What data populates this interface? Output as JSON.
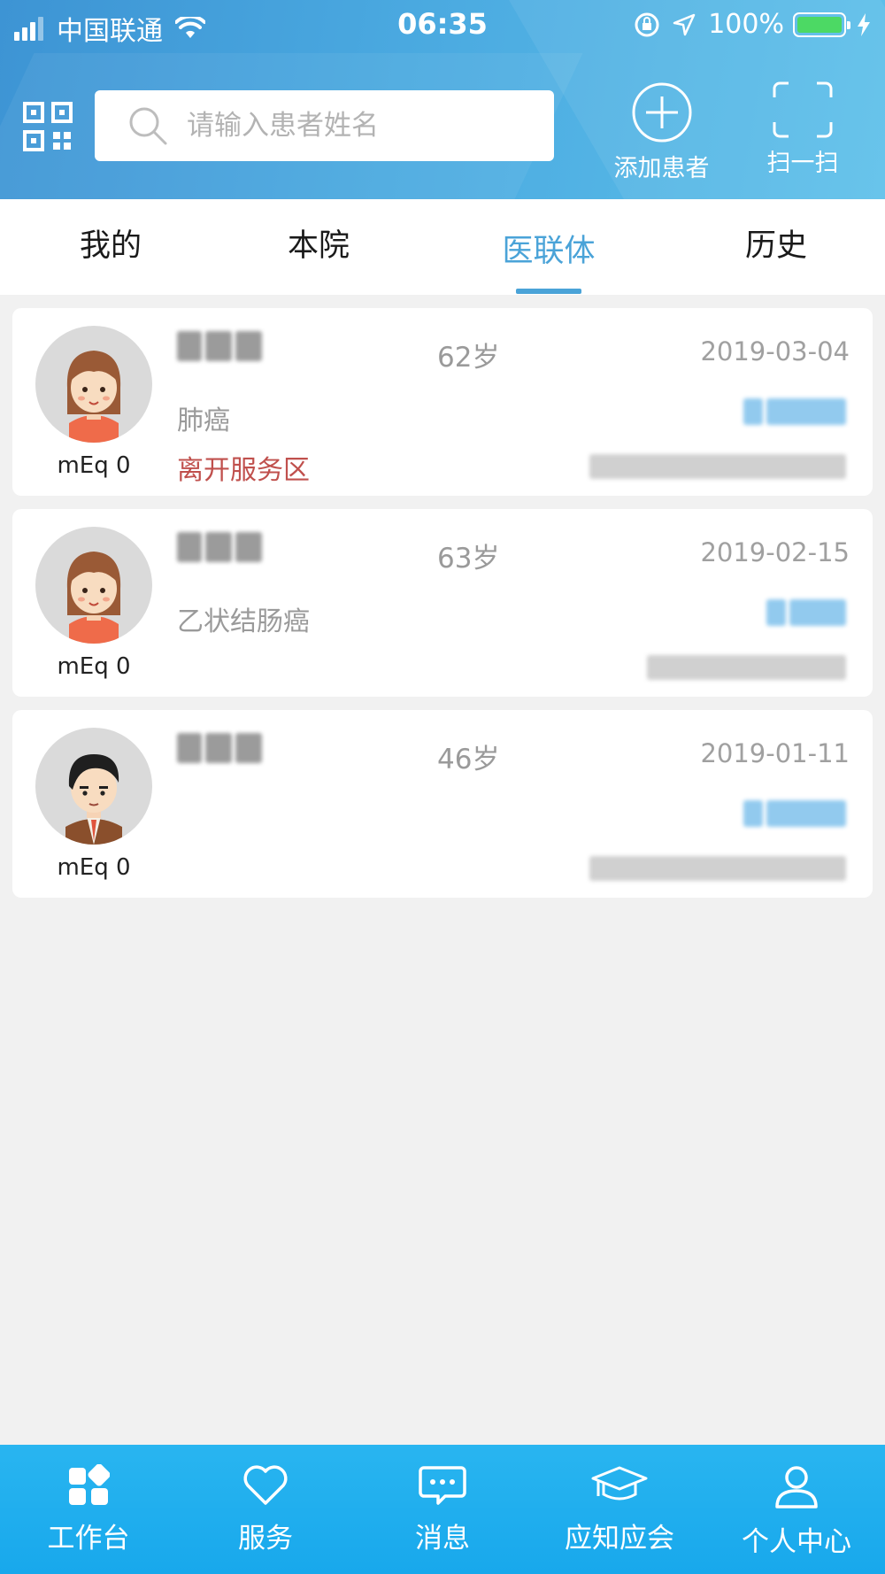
{
  "status_bar": {
    "carrier": "中国联通",
    "time": "06:35",
    "battery": "100%"
  },
  "header": {
    "search_placeholder": "请输入患者姓名",
    "add_patient_label": "添加患者",
    "scan_label": "扫一扫"
  },
  "tabs": [
    {
      "label": "我的"
    },
    {
      "label": "本院"
    },
    {
      "label": "医联体"
    },
    {
      "label": "历史"
    }
  ],
  "active_tab": "医联体",
  "patients": [
    {
      "meq": "mEq 0",
      "age": "62岁",
      "date": "2019-03-04",
      "disease": "肺癌",
      "status": "离开服务区",
      "avatar": "female-avatar"
    },
    {
      "meq": "mEq 0",
      "age": "63岁",
      "date": "2019-02-15",
      "disease": "乙状结肠癌",
      "status": "",
      "avatar": "female-avatar"
    },
    {
      "meq": "mEq 0",
      "age": "46岁",
      "date": "2019-01-11",
      "disease": "",
      "status": "",
      "avatar": "male-avatar"
    }
  ],
  "bottom_nav": [
    {
      "label": "工作台",
      "icon": "grid-icon"
    },
    {
      "label": "服务",
      "icon": "heart-icon"
    },
    {
      "label": "消息",
      "icon": "message-icon"
    },
    {
      "label": "应知应会",
      "icon": "graduation-cap-icon"
    },
    {
      "label": "个人中心",
      "icon": "person-icon"
    }
  ],
  "colors": {
    "header_gradient_start": "#3d94d4",
    "header_gradient_end": "#5dc0ea",
    "active_tab": "#4aa3d8",
    "status_red": "#c0504d",
    "bottom_bar": "#1eaef0"
  }
}
